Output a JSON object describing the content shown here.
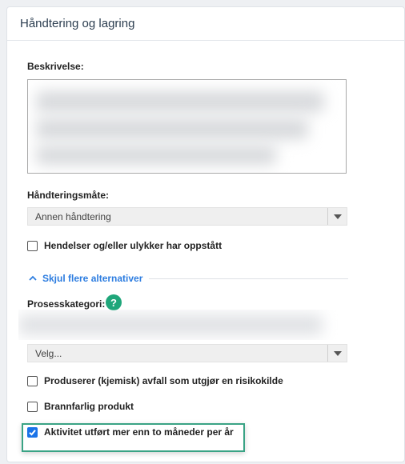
{
  "card": {
    "title": "Håndtering og lagring"
  },
  "description": {
    "label": "Beskrivelse:"
  },
  "handling": {
    "label": "Håndteringsmåte:",
    "selected": "Annen håndtering"
  },
  "incidents": {
    "label": "Hendelser og/eller ulykker har oppstått",
    "checked": false
  },
  "toggle": {
    "label": "Skjul flere alternativer"
  },
  "process": {
    "label": "Prosesskategori:",
    "help_text": "?",
    "select_value": "Velg..."
  },
  "checkboxes": [
    {
      "label": "Produserer (kjemisk) avfall som utgjør en risikokilde",
      "checked": false
    },
    {
      "label": "Brannfarlig produkt",
      "checked": false
    },
    {
      "label": "Aktivitet utført mer enn to måneder per år",
      "checked": true
    }
  ],
  "colors": {
    "accent_blue": "#2d7de0",
    "check_blue": "#1a73e8",
    "help_green": "#1fa67a",
    "highlight_green": "#3aa385"
  }
}
